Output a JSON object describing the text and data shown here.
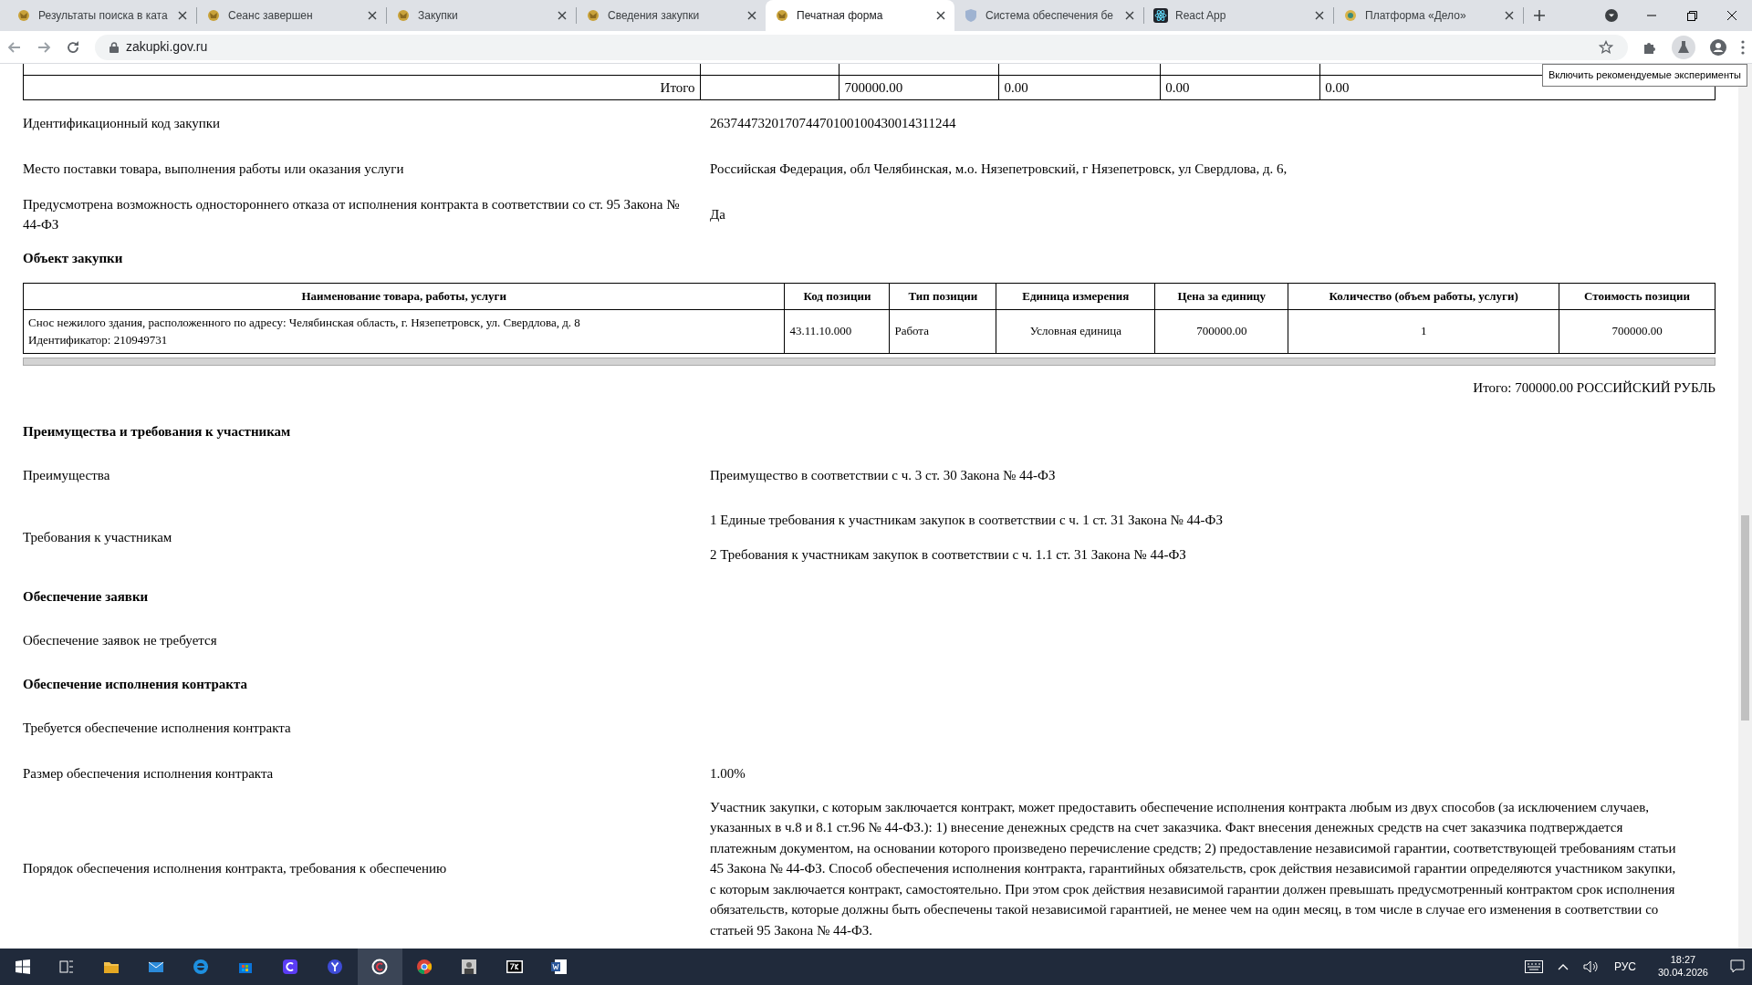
{
  "browser": {
    "tabs": [
      {
        "title": "Результаты поиска в ката",
        "kind": "emblem",
        "selected": false
      },
      {
        "title": "Сеанс завершен",
        "kind": "emblem",
        "selected": false
      },
      {
        "title": "Закупки",
        "kind": "emblem",
        "selected": false
      },
      {
        "title": "Сведения закупки",
        "kind": "emblem",
        "selected": false
      },
      {
        "title": "Печатная форма",
        "kind": "emblem",
        "selected": true
      },
      {
        "title": "Система обеспечения бе",
        "kind": "shield",
        "selected": false
      },
      {
        "title": "React App",
        "kind": "react",
        "selected": false
      },
      {
        "title": "Платформа «Дело»",
        "kind": "delo",
        "selected": false
      }
    ],
    "url": "zakupki.gov.ru",
    "tooltip": "Включить рекомендуемые эксперименты"
  },
  "page": {
    "top_table": {
      "total_row": {
        "label": "Итого",
        "cells": [
          "700000.00",
          "0.00",
          "0.00",
          "0.00"
        ]
      }
    },
    "sections": [
      {
        "kind": "field",
        "label": "Идентификационный код закупки",
        "values": [
          "263744732017074470100100430014311244"
        ]
      },
      {
        "kind": "field",
        "label": "Место поставки товара, выполнения работы или оказания услуги",
        "values": [
          "Российская Федерация, обл Челябинская, м.о. Нязепетровский, г Нязепетровск, ул Свердлова, д. 6,"
        ]
      },
      {
        "kind": "field",
        "label": "Предусмотрена возможность одностороннего отказа от исполнения контракта в соответствии со ст. 95 Закона № 44-ФЗ",
        "values": [
          "Да"
        ]
      },
      {
        "kind": "heading",
        "text": "Объект закупки"
      },
      {
        "kind": "table",
        "columns": [
          "Наименование товара, работы, услуги",
          "Код позиции",
          "Тип позиции",
          "Единица измерения",
          "Цена за единицу",
          "Количество (объем работы, услуги)",
          "Стоимость позиции"
        ],
        "rows": [
          [
            "Снос нежилого здания, расположенного по адресу: Челябинская область, г. Нязепетровск, ул. Свердлова, д. 8",
            "43.11.10.000",
            "Работа",
            "Условная единица",
            "700000.00",
            "1",
            "700000.00"
          ]
        ],
        "row_id": "Идентификатор: 210949731"
      },
      {
        "kind": "total",
        "text": "Итого: 700000.00 РОССИЙСКИЙ РУБЛЬ"
      },
      {
        "kind": "heading",
        "text": "Преимущества и требования к участникам"
      },
      {
        "kind": "field",
        "label": "Преимущества",
        "values": [
          "Преимущество в соответствии с ч. 3 ст. 30 Закона № 44-ФЗ"
        ]
      },
      {
        "kind": "field",
        "label": "Требования к участникам",
        "values": [
          "1 Единые требования к участникам закупок в соответствии с ч. 1 ст. 31 Закона № 44-ФЗ",
          "2 Требования к участникам закупок в соответствии с ч. 1.1 ст. 31 Закона № 44-ФЗ"
        ]
      },
      {
        "kind": "heading",
        "text": "Обеспечение заявки"
      },
      {
        "kind": "note",
        "text": "Обеспечение заявок не требуется"
      },
      {
        "kind": "heading",
        "text": "Обеспечение исполнения контракта"
      },
      {
        "kind": "note",
        "text": "Требуется обеспечение исполнения контракта"
      },
      {
        "kind": "field",
        "label": "Размер обеспечения исполнения контракта",
        "values": [
          "1.00%"
        ]
      },
      {
        "kind": "field",
        "label": "Порядок обеспечения исполнения контракта, требования к обеспечению",
        "values": [
          "Участник закупки, с которым заключается контракт, может предоставить обеспечение исполнения контракта любым из двух способов (за исключением случаев, указанных в ч.8 и 8.1 ст.96 № 44-ФЗ.): 1) внесение денежных средств на счет заказчика. Факт внесения денежных средств на счет заказчика подтверждается платежным документом, на основании которого произведено перечисление средств; 2) предоставление независимой гарантии, соответствующей требованиям статьи 45 Закона № 44-ФЗ. Способ обеспечения исполнения контракта, гарантийных обязательств, срок действия независимой гарантии определяются участником закупки, с которым заключается контракт, самостоятельно. При этом срок действия независимой гарантии должен превышать предусмотренный контрактом срок исполнения обязательств, которые должны быть обеспечены такой независимой гарантией, не менее чем на один месяц, в том числе в случае его изменения в соответствии со статьей 95 Закона № 44-ФЗ."
        ]
      }
    ]
  },
  "taskbar": {
    "apps": [
      {
        "kind": "task-view",
        "selected": false
      },
      {
        "kind": "folder",
        "selected": false
      },
      {
        "kind": "mail",
        "selected": false
      },
      {
        "kind": "edge",
        "selected": false
      },
      {
        "kind": "store",
        "selected": false
      },
      {
        "kind": "c-app",
        "selected": false
      },
      {
        "kind": "y-browser",
        "selected": false
      },
      {
        "kind": "c-ring",
        "selected": true
      },
      {
        "kind": "chrome",
        "selected": false
      },
      {
        "kind": "picture-app",
        "selected": false
      },
      {
        "kind": "archiver",
        "selected": false
      },
      {
        "kind": "word",
        "selected": false
      }
    ],
    "language": "РУС",
    "time": "18:27",
    "date": "30.04.2026"
  }
}
